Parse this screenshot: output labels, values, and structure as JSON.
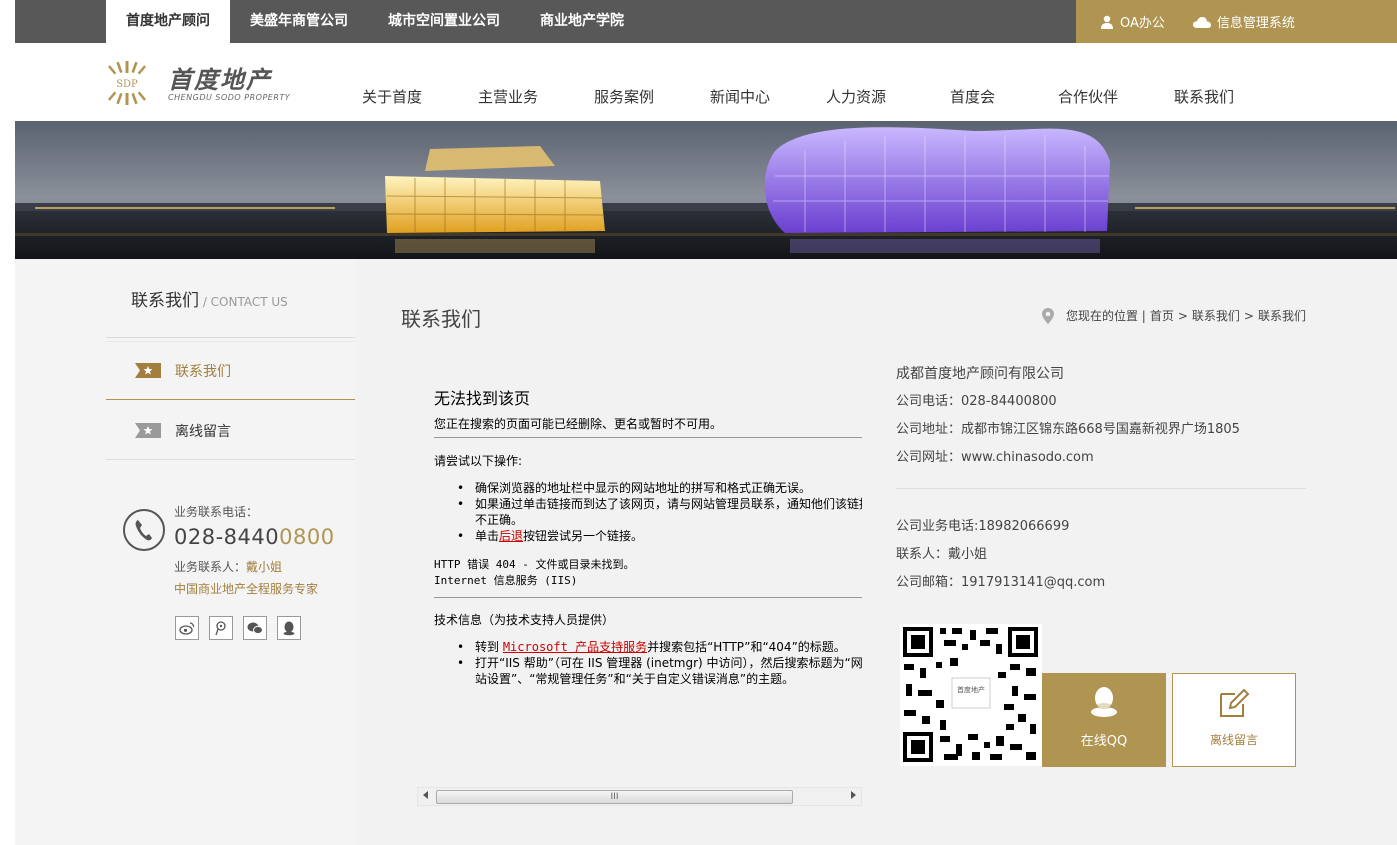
{
  "colors": {
    "gold": "#b09552",
    "topbar": "#585858",
    "sidebar_bg": "#f4f4f4",
    "main_bg": "#f2f2f2",
    "error_link": "#cc0000"
  },
  "topbar": {
    "tabs": [
      {
        "label": "首度地产顾问",
        "active": true
      },
      {
        "label": "美盛年商管公司",
        "active": false
      },
      {
        "label": "城市空间置业公司",
        "active": false
      },
      {
        "label": "商业地产学院",
        "active": false
      }
    ],
    "oa_label": "OA办公",
    "oa_icon": "user-icon",
    "info_label": "信息管理系统",
    "info_icon": "cloud-icon"
  },
  "logo": {
    "badge": "SDP",
    "cn": "首度地产",
    "en": "CHENGDU SODO PROPERTY"
  },
  "nav": [
    {
      "label": "关于首度"
    },
    {
      "label": "主营业务"
    },
    {
      "label": "服务案例"
    },
    {
      "label": "新闻中心"
    },
    {
      "label": "人力资源"
    },
    {
      "label": "首度会"
    },
    {
      "label": "合作伙伴"
    },
    {
      "label": "联系我们"
    }
  ],
  "sidebar": {
    "title": "联系我们",
    "title_en": " / CONTACT US",
    "items": [
      {
        "label": "联系我们",
        "active": true,
        "icon": "star-tag-icon"
      },
      {
        "label": "离线留言",
        "active": false,
        "icon": "star-tag-icon"
      }
    ],
    "phone_label": "业务联系电话：",
    "phone_main": "028-8440",
    "phone_tail": "0800",
    "person_label": "业务联系人：",
    "person_name": "戴小姐",
    "slogan": "中国商业地产全程服务专家",
    "socials": [
      "weibo-icon",
      "tencent-weibo-icon",
      "wechat-icon",
      "qq-icon"
    ]
  },
  "main": {
    "title": "联系我们",
    "breadcrumb": {
      "prefix": "您现在的位置 | ",
      "home": "首页",
      "sep": ">",
      "level1": "联系我们",
      "level2": "联系我们"
    }
  },
  "error_page": {
    "heading": "无法找到该页",
    "subtitle": "您正在搜索的页面可能已经删除、更名或暂时不可用。",
    "try_title": "请尝试以下操作:",
    "tips": [
      "确保浏览器的地址栏中显示的网站地址的拼写和格式正确无误。",
      "如果通过单击链接而到达了该网页，请与网站管理员联系，通知他们该链接",
      "不正确。"
    ],
    "tip3_prefix": "单击",
    "tip3_link": "后退",
    "tip3_suffix": "按钮尝试另一个链接。",
    "http_error": "HTTP 错误 404 - 文件或目录未找到。",
    "iis": "Internet 信息服务 (IIS)",
    "tech_title": "技术信息（为技术支持人员提供）",
    "tech1_prefix": "转到 ",
    "tech1_link": "Microsoft 产品支持服务",
    "tech1_suffix": "并搜索包括“HTTP”和“404”的标题。",
    "tech2_line1": "打开“IIS 帮助”（可在 IIS 管理器 (inetmgr) 中访问），然后搜索标题为“网",
    "tech2_line2": "站设置”、“常规管理任务”和“关于自定义错误消息”的主题。",
    "scroll_grip": "III"
  },
  "info": {
    "company": "成都首度地产顾问有限公司",
    "tel": "公司电话：028-84400800",
    "address": "公司地址：成都市锦江区锦东路668号国嘉新视界广场1805",
    "website": "公司网址：www.chinasodo.com",
    "biz_tel": "公司业务电话:18982066699",
    "contact": "联系人：戴小姐",
    "email": "公司邮箱：1917913141@qq.com",
    "qr_label": "首度地产",
    "qq_label": "在线QQ",
    "message_label": "离线留言"
  }
}
